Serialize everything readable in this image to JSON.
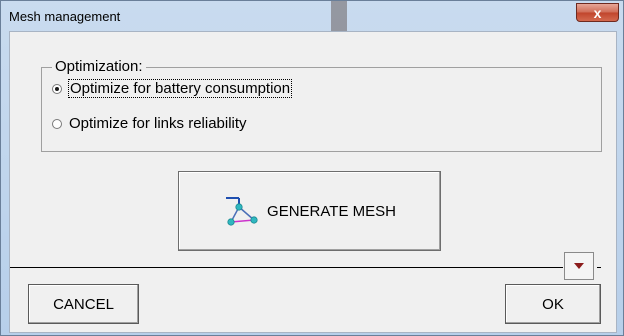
{
  "window": {
    "title": "Mesh management",
    "close_glyph": "x"
  },
  "optimization": {
    "legend": "Optimization:",
    "options": [
      {
        "label": "Optimize for battery consumption",
        "checked": true
      },
      {
        "label": "Optimize for links reliability",
        "checked": false
      }
    ]
  },
  "generate": {
    "label": "GENERATE MESH",
    "icon": "mesh-network-icon"
  },
  "dropdown": {
    "icon": "triangle-down-icon"
  },
  "buttons": {
    "cancel": "CANCEL",
    "ok": "OK"
  },
  "colors": {
    "titlebar": "#c9dbef",
    "close_button": "#c1452c",
    "dialog_bg": "#f0f0f0",
    "mesh_node": "#2fb7c0",
    "mesh_link_blue": "#1f4fb0",
    "mesh_link_magenta": "#cc33cc",
    "dropdown_arrow": "#8b1c1c"
  }
}
